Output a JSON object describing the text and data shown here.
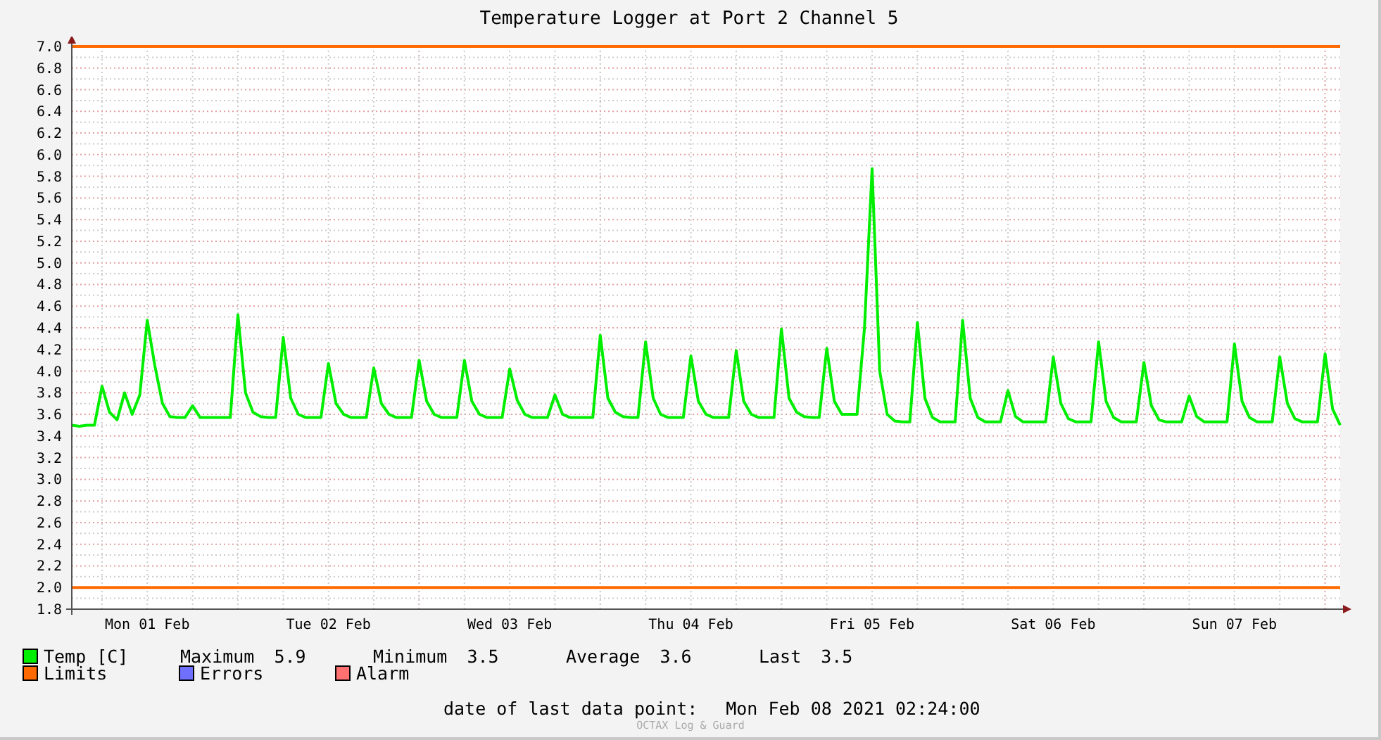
{
  "window": {
    "title": "Temperature Logger at Port 2 Channel 5"
  },
  "chart": {
    "chart_data": {
      "type": "line",
      "categories": [
        null,
        null,
        null,
        null,
        null,
        null,
        null,
        null,
        null,
        null,
        "Mon 01 Feb",
        null,
        null,
        null,
        null,
        null,
        null,
        null,
        null,
        null,
        null,
        null,
        null,
        null,
        null,
        null,
        null,
        null,
        null,
        null,
        null,
        null,
        null,
        null,
        "Tue 02 Feb",
        null,
        null,
        null,
        null,
        null,
        null,
        null,
        null,
        null,
        null,
        null,
        null,
        null,
        null,
        null,
        null,
        null,
        null,
        null,
        null,
        null,
        null,
        null,
        "Wed 03 Feb",
        null,
        null,
        null,
        null,
        null,
        null,
        null,
        null,
        null,
        null,
        null,
        null,
        null,
        null,
        null,
        null,
        null,
        null,
        null,
        null,
        null,
        null,
        null,
        "Thu 04 Feb",
        null,
        null,
        null,
        null,
        null,
        null,
        null,
        null,
        null,
        null,
        null,
        null,
        null,
        null,
        null,
        null,
        null,
        null,
        null,
        null,
        null,
        null,
        null,
        "Fri 05 Feb",
        null,
        null,
        null,
        null,
        null,
        null,
        null,
        null,
        null,
        null,
        null,
        null,
        null,
        null,
        null,
        null,
        null,
        null,
        null,
        null,
        null,
        null,
        null,
        "Sat 06 Feb",
        null,
        null,
        null,
        null,
        null,
        null,
        null,
        null,
        null,
        null,
        null,
        null,
        null,
        null,
        null,
        null,
        null,
        null,
        null,
        null,
        null,
        null,
        null,
        "Sun 07 Feb",
        null,
        null,
        null,
        null,
        null,
        null,
        null,
        null,
        null,
        null,
        null,
        null,
        null,
        null
      ],
      "series": [
        {
          "name": "Temp [C]",
          "color": "#00ee00",
          "values": [
            3.5,
            3.49,
            3.5,
            3.5,
            3.86,
            3.62,
            3.55,
            3.8,
            3.6,
            3.78,
            4.47,
            4.05,
            3.7,
            3.58,
            3.57,
            3.57,
            3.68,
            3.57,
            3.57,
            3.57,
            3.57,
            3.57,
            4.52,
            3.8,
            3.62,
            3.58,
            3.57,
            3.57,
            4.31,
            3.75,
            3.6,
            3.57,
            3.57,
            3.57,
            4.07,
            3.7,
            3.6,
            3.57,
            3.57,
            3.57,
            4.03,
            3.7,
            3.6,
            3.57,
            3.57,
            3.57,
            4.1,
            3.72,
            3.6,
            3.57,
            3.57,
            3.57,
            4.1,
            3.72,
            3.6,
            3.57,
            3.57,
            3.57,
            4.02,
            3.73,
            3.6,
            3.57,
            3.57,
            3.57,
            3.78,
            3.6,
            3.57,
            3.57,
            3.57,
            3.57,
            4.33,
            3.75,
            3.62,
            3.58,
            3.57,
            3.57,
            4.27,
            3.75,
            3.6,
            3.57,
            3.57,
            3.57,
            4.14,
            3.72,
            3.6,
            3.57,
            3.57,
            3.57,
            4.19,
            3.72,
            3.6,
            3.57,
            3.57,
            3.57,
            4.39,
            3.75,
            3.62,
            3.58,
            3.57,
            3.57,
            4.21,
            3.72,
            3.6,
            3.6,
            3.6,
            4.4,
            5.87,
            4.0,
            3.6,
            3.54,
            3.53,
            3.53,
            4.45,
            3.75,
            3.57,
            3.53,
            3.53,
            3.53,
            4.47,
            3.75,
            3.57,
            3.53,
            3.53,
            3.53,
            3.82,
            3.58,
            3.53,
            3.53,
            3.53,
            3.53,
            4.13,
            3.7,
            3.56,
            3.53,
            3.53,
            3.53,
            4.27,
            3.72,
            3.57,
            3.53,
            3.53,
            3.53,
            4.08,
            3.68,
            3.55,
            3.53,
            3.53,
            3.53,
            3.77,
            3.58,
            3.53,
            3.53,
            3.53,
            3.53,
            4.25,
            3.72,
            3.57,
            3.53,
            3.53,
            3.53,
            4.13,
            3.7,
            3.56,
            3.53,
            3.53,
            3.53,
            4.16,
            3.65,
            3.5
          ]
        }
      ],
      "ylim": [
        1.8,
        7.0
      ],
      "yticks": [
        1.8,
        {
          "value": 2,
          "label": "2.0"
        },
        2.2,
        2.4,
        2.6,
        2.8,
        {
          "value": 3,
          "label": "3.0"
        },
        3.2,
        3.4,
        3.6,
        3.8,
        {
          "value": 4,
          "label": "4.0"
        },
        4.2,
        4.4,
        4.6,
        4.8,
        {
          "value": 5,
          "label": "5.0"
        },
        5.2,
        5.4,
        5.6,
        5.8,
        {
          "value": 6,
          "label": "6.0"
        },
        6.2,
        6.4,
        6.6,
        6.8,
        {
          "value": 7,
          "label": "7.0"
        }
      ],
      "grid": true,
      "ref_lines": [
        {
          "axis": "y",
          "value": 7.0,
          "color": "#ff6a00"
        },
        {
          "axis": "y",
          "value": 2.0,
          "color": "#ff6a00"
        }
      ]
    }
  },
  "stats": [
    {
      "label": "Maximum",
      "value": "5.9"
    },
    {
      "label": "Minimum",
      "value": "3.5"
    },
    {
      "label": "Average",
      "value": "3.6"
    },
    {
      "label": "Last",
      "value": "3.5"
    }
  ],
  "legend": [
    {
      "label": "Limits",
      "color": "#ff6a00"
    },
    {
      "label": "Errors",
      "color": "#7070ff"
    },
    {
      "label": "Alarm",
      "color": "#ff7070"
    }
  ],
  "last_data_point": {
    "label": "date of last data point:",
    "value": "Mon Feb 08 2021 02:24:00"
  },
  "footer": "OCTAX Log & Guard"
}
